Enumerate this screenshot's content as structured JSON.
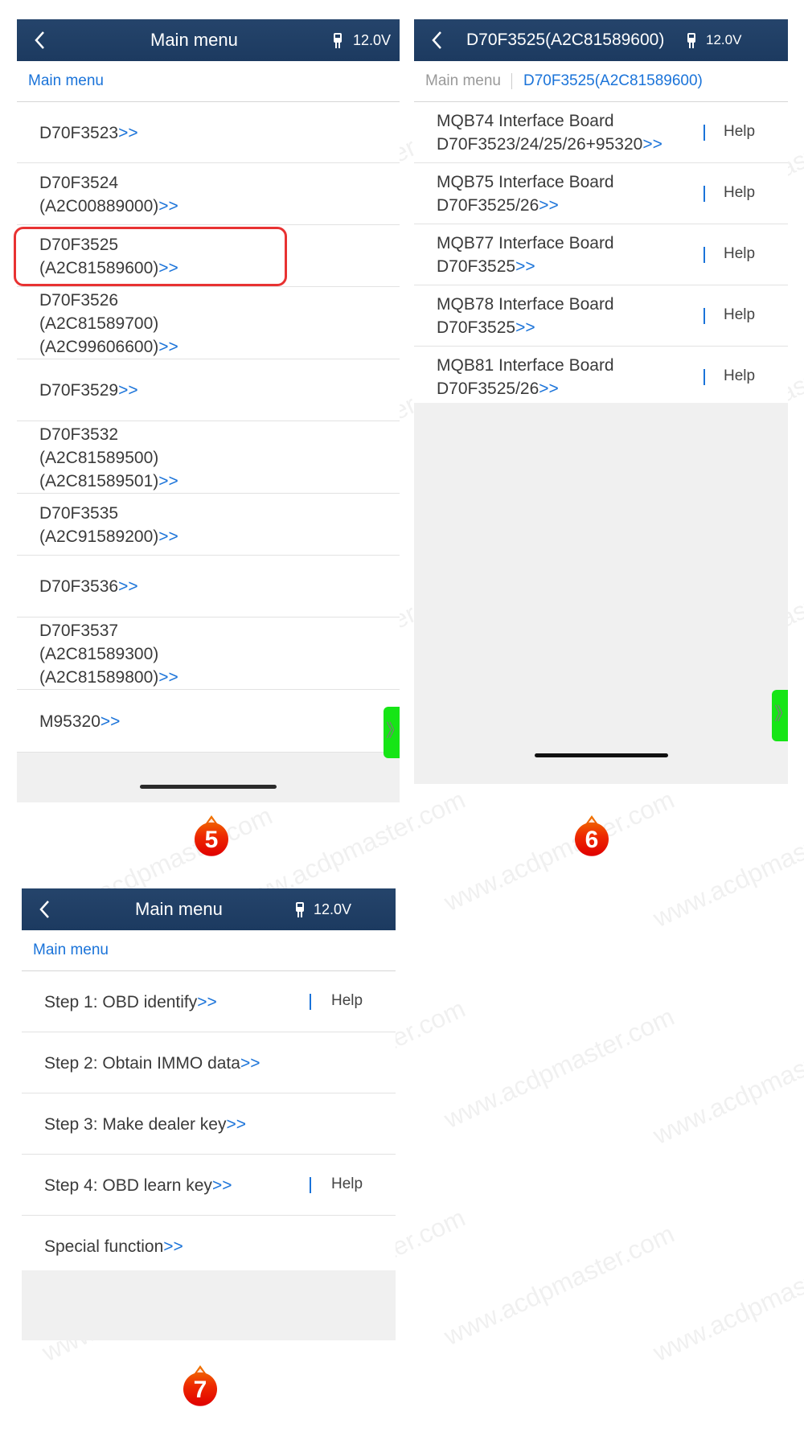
{
  "panel5": {
    "header": {
      "title": "Main menu",
      "voltage": "12.0V"
    },
    "breadcrumb": [
      "Main menu"
    ],
    "items": [
      {
        "lines": [
          "D70F3523"
        ],
        "arrow": ">>"
      },
      {
        "lines": [
          "D70F3524",
          "(A2C00889000)"
        ],
        "arrow": ">>"
      },
      {
        "lines": [
          "D70F3525",
          "(A2C81589600)"
        ],
        "arrow": ">>",
        "highlighted": true
      },
      {
        "lines": [
          "D70F3526",
          "(A2C81589700)",
          "(A2C99606600)"
        ],
        "arrow": ">>"
      },
      {
        "lines": [
          "D70F3529"
        ],
        "arrow": ">>"
      },
      {
        "lines": [
          "D70F3532",
          "(A2C81589500)",
          "(A2C81589501)"
        ],
        "arrow": ">>"
      },
      {
        "lines": [
          "D70F3535",
          "(A2C91589200)"
        ],
        "arrow": ">>"
      },
      {
        "lines": [
          "D70F3536"
        ],
        "arrow": ">>"
      },
      {
        "lines": [
          "D70F3537",
          "(A2C81589300)",
          "(A2C81589800)"
        ],
        "arrow": ">>"
      },
      {
        "lines": [
          "M95320"
        ],
        "arrow": ">>"
      }
    ],
    "side_tab_glyph": "》",
    "step_badge": "5"
  },
  "panel6": {
    "header": {
      "title": "D70F3525(A2C81589600)",
      "voltage": "12.0V"
    },
    "breadcrumb": [
      "Main menu",
      "D70F3525(A2C81589600)"
    ],
    "items": [
      {
        "lines": [
          "MQB74 Interface Board",
          "D70F3523/24/25/26+95320"
        ],
        "arrow": ">>",
        "help": "Help"
      },
      {
        "lines": [
          "MQB75 Interface Board",
          "D70F3525/26"
        ],
        "arrow": ">>",
        "help": "Help"
      },
      {
        "lines": [
          "MQB77 Interface Board",
          "D70F3525"
        ],
        "arrow": ">>",
        "help": "Help"
      },
      {
        "lines": [
          "MQB78 Interface Board",
          "D70F3525"
        ],
        "arrow": ">>",
        "help": "Help"
      },
      {
        "lines": [
          "MQB81 Interface Board",
          "D70F3525/26"
        ],
        "arrow": ">>",
        "help": "Help"
      }
    ],
    "side_tab_glyph": "》",
    "step_badge": "6"
  },
  "panel7": {
    "header": {
      "title": "Main menu",
      "voltage": "12.0V"
    },
    "breadcrumb": [
      "Main menu"
    ],
    "items": [
      {
        "lines": [
          "Step 1: OBD identify"
        ],
        "arrow": ">>",
        "help": "Help"
      },
      {
        "lines": [
          "Step 2: Obtain IMMO data"
        ],
        "arrow": ">>"
      },
      {
        "lines": [
          "Step 3: Make dealer key"
        ],
        "arrow": ">>"
      },
      {
        "lines": [
          "Step 4: OBD learn key"
        ],
        "arrow": ">>",
        "help": "Help"
      },
      {
        "lines": [
          "Special function"
        ],
        "arrow": ">>"
      }
    ],
    "step_badge": "7"
  },
  "watermark": "www.acdpmaster.com",
  "colors": {
    "header": "#1f3d63",
    "link": "#1a73d9",
    "highlight": "#e83232",
    "side_tab": "#16e516",
    "badge": "#ee2a00"
  }
}
